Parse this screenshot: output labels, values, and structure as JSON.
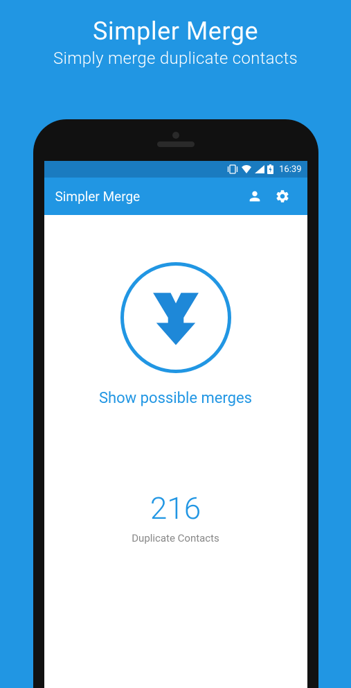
{
  "promo": {
    "title": "Simpler Merge",
    "subtitle": "Simply merge duplicate contacts"
  },
  "statusbar": {
    "time": "16:39"
  },
  "appbar": {
    "title": "Simpler Merge"
  },
  "main": {
    "action_label": "Show possible merges",
    "duplicate_count": "216",
    "duplicate_label": "Duplicate Contacts"
  }
}
